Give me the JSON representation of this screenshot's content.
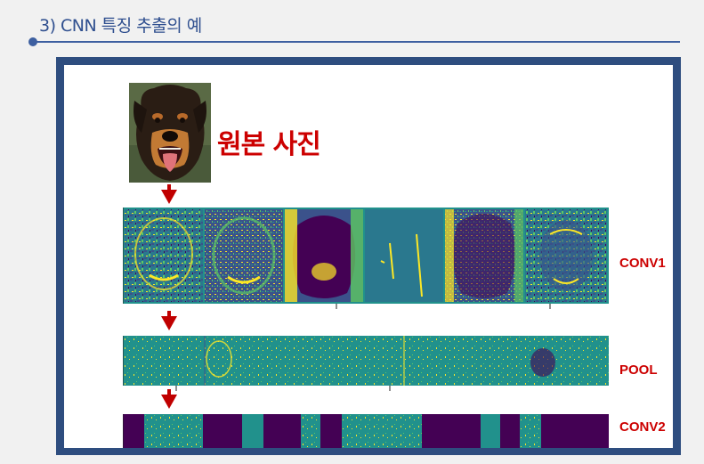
{
  "header": {
    "title": "3) CNN 특징 추출의 예"
  },
  "figure": {
    "photo_label": "원본 사진",
    "layers": [
      {
        "label": "CONV1"
      },
      {
        "label": "POOL"
      },
      {
        "label": "CONV2"
      }
    ]
  },
  "colors": {
    "accent_blue": "#2e4d7f",
    "label_red": "#cc0000",
    "viridis_dark": "#440154",
    "viridis_mid": "#21918c",
    "viridis_yellow": "#fde725"
  },
  "icons": {
    "arrow": "down-arrow-icon",
    "bullet": "circle-bullet-icon"
  }
}
